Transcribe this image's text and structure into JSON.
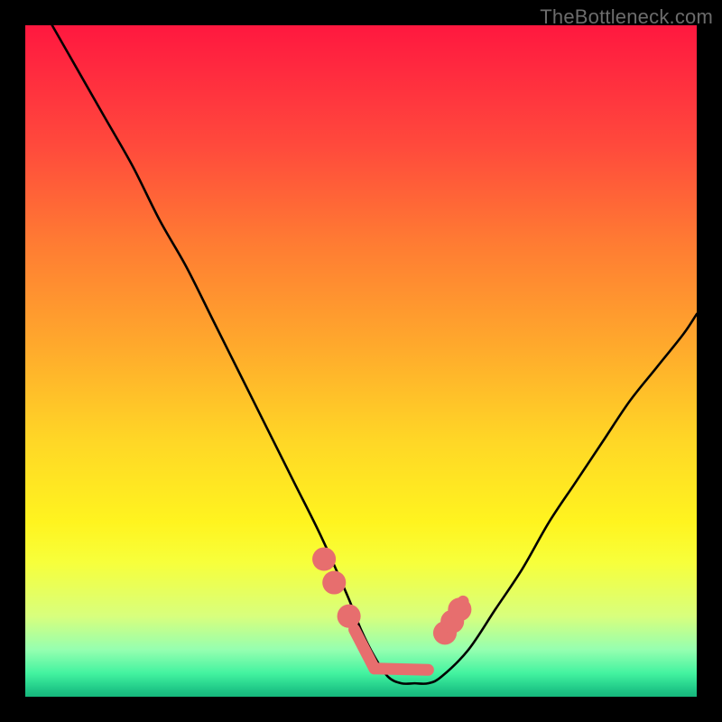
{
  "watermark": "TheBottleneck.com",
  "colors": {
    "frame": "#000000",
    "curve": "#000000",
    "marker": "#e76e6e",
    "gradient_top": "#ff183f",
    "gradient_bottom": "#16b77c"
  },
  "chart_data": {
    "type": "line",
    "title": "",
    "xlabel": "",
    "ylabel": "",
    "xlim": [
      0,
      100
    ],
    "ylim": [
      0,
      100
    ],
    "annotations": [
      "TheBottleneck.com"
    ],
    "series": [
      {
        "name": "bottleneck-curve",
        "x": [
          4,
          8,
          12,
          16,
          20,
          24,
          28,
          32,
          36,
          40,
          44,
          48,
          50,
          52,
          54,
          56,
          58,
          60,
          62,
          66,
          70,
          74,
          78,
          82,
          86,
          90,
          94,
          98,
          100
        ],
        "y": [
          100,
          93,
          86,
          79,
          71,
          64,
          56,
          48,
          40,
          32,
          24,
          15,
          10,
          6,
          3,
          2,
          2,
          2,
          3,
          7,
          13,
          19,
          26,
          32,
          38,
          44,
          49,
          54,
          57
        ]
      }
    ],
    "markers": [
      {
        "x": 44.5,
        "y": 20.5,
        "r": 1.2
      },
      {
        "x": 46.0,
        "y": 17.0,
        "r": 1.2
      },
      {
        "x": 48.2,
        "y": 12.0,
        "r": 1.2
      },
      {
        "x": 62.5,
        "y": 9.5,
        "r": 1.2
      },
      {
        "x": 63.6,
        "y": 11.2,
        "r": 1.2
      },
      {
        "x": 64.7,
        "y": 13.0,
        "r": 1.2
      }
    ],
    "thick_segments": [
      {
        "x1": 49.0,
        "y1": 10.0,
        "x2": 52.0,
        "y2": 4.2
      },
      {
        "x1": 52.0,
        "y1": 4.2,
        "x2": 60.0,
        "y2": 4.0
      },
      {
        "x1": 62.0,
        "y1": 9.0,
        "x2": 65.2,
        "y2": 14.2
      }
    ]
  }
}
